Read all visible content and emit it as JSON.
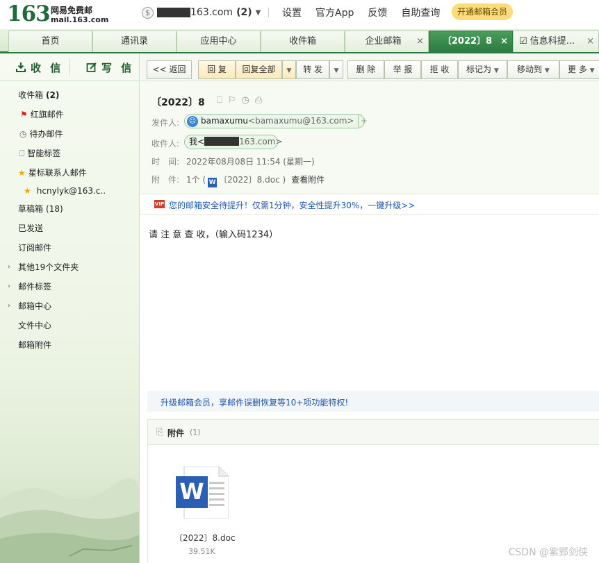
{
  "brand": {
    "logo_number": "163",
    "logo_cn": "网易免费邮",
    "logo_url": "mail.163.com"
  },
  "account": {
    "coin_icon": "$",
    "email_suffix": "163.com",
    "count": "(2)"
  },
  "toplinks": [
    "设置",
    "官方App",
    "反馈",
    "自助查询"
  ],
  "vip_button": "开通邮箱会员",
  "tabs": [
    {
      "label": "首页"
    },
    {
      "label": "通讯录"
    },
    {
      "label": "应用中心"
    },
    {
      "label": "收件箱"
    },
    {
      "label": "企业邮箱"
    },
    {
      "label": "〔2022〕8"
    },
    {
      "label": "信息科提..."
    }
  ],
  "sidebar": {
    "receive_label": "收 信",
    "write_label": "写 信",
    "folders": [
      {
        "label": "收件箱",
        "count": "(2)"
      },
      {
        "label": "红旗邮件"
      },
      {
        "label": "待办邮件"
      },
      {
        "label": "智能标签"
      },
      {
        "label": "星标联系人邮件"
      },
      {
        "label": "hcnylyk@163.c.."
      },
      {
        "label": "草稿箱",
        "count": "(18)"
      },
      {
        "label": "已发送"
      },
      {
        "label": "订阅邮件"
      },
      {
        "label": "其他19个文件夹"
      },
      {
        "label": "邮件标签"
      },
      {
        "label": "邮箱中心"
      },
      {
        "label": "文件中心"
      },
      {
        "label": "邮箱附件"
      }
    ]
  },
  "toolbar": {
    "back": "<< 返回",
    "reply": "回 复",
    "reply_all": "回复全部",
    "forward": "转 发",
    "delete": "删 除",
    "report": "举 报",
    "reject": "拒 收",
    "mark_as": "标记为",
    "move_to": "移动到",
    "more": "更 多"
  },
  "email": {
    "subject": "〔2022〕8",
    "from_label": "发件人:",
    "from_name": "bamaxumu",
    "from_addr": "<bamaxumu@163.com>",
    "to_label": "收件人:",
    "to_name": "我<",
    "to_suffix": "163.com>",
    "time_label": "时　间:",
    "time_value": "2022年08月08日 11:54 (星期一)",
    "attach_label": "附　件:",
    "attach_count": "1个 (",
    "attach_file": "〔2022〕8.doc )",
    "view_attach": "查看附件",
    "body": "请 注 意 查 收，（输入码1234）"
  },
  "promo_security": "您的邮箱安全待提升！仅需1分钟，安全性提升30%，一键升级>>",
  "promo_vip": "升级邮箱会员，享邮件误删恢复等10+项功能特权!",
  "attachment_panel": {
    "title": "附件",
    "count": "(1)",
    "file_name": "〔2022〕8.doc",
    "file_size": "39.51K"
  },
  "watermark": "CSDN @紫郢剑侠",
  "colors": {
    "brand_green": "#2c7a40",
    "link_blue": "#1e56a8",
    "vip_yellow": "#fbdc7a",
    "word_blue": "#2b5fb4"
  }
}
